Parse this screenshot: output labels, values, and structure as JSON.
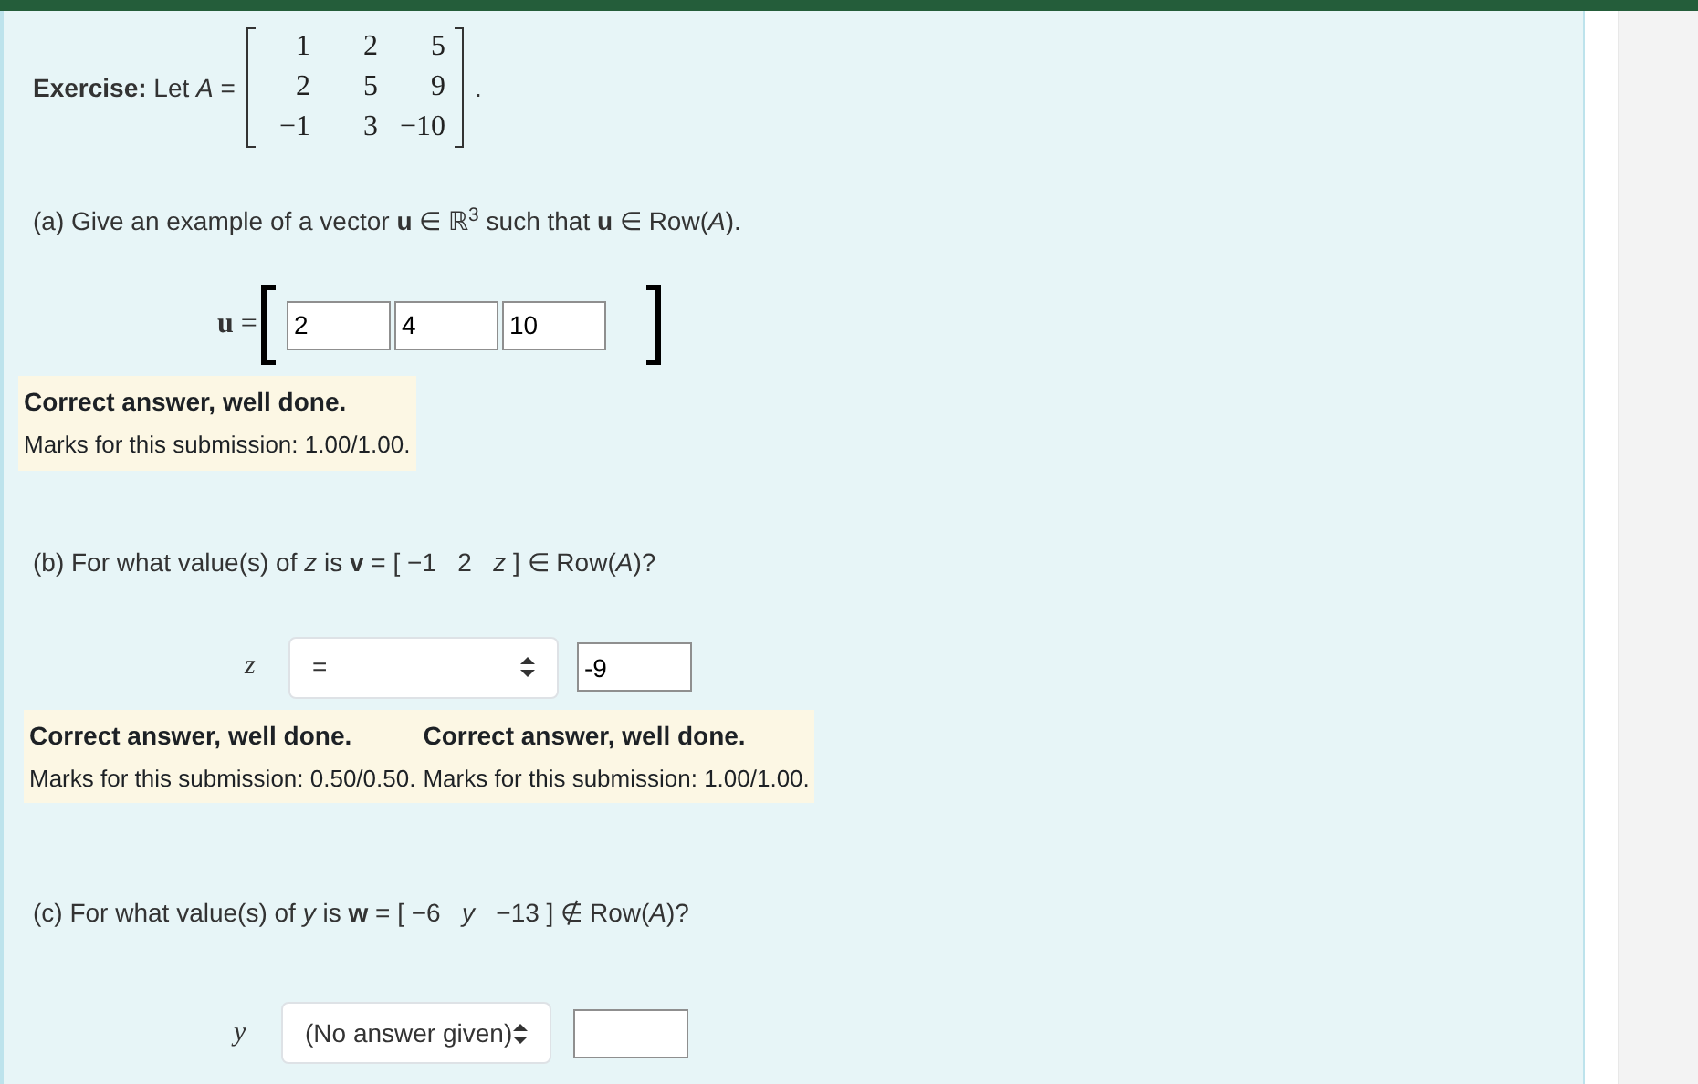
{
  "exercise": {
    "intro": "**Exercise:** Let *A* =",
    "matrix": [
      [
        "1",
        "2",
        "5"
      ],
      [
        "2",
        "5",
        "9"
      ],
      [
        "−1",
        "3",
        "−10"
      ]
    ],
    "end": "."
  },
  "part_a": {
    "question": "(a) Give an example of a vector **u** ∈ ℝ$^{3}$ such that **u** ∈ Row(*A*).",
    "label": "**u** =",
    "inputs": [
      "2",
      "4",
      "10"
    ],
    "feedback": [
      {
        "title": "Correct answer, well done.",
        "marks": "Marks for this submission: 1.00/1.00."
      }
    ]
  },
  "part_b": {
    "question": "(b) For what value(s) of *z* is **v** = [ −1   2   *z* ] ∈ Row(*A*)?",
    "variable": "z",
    "select": "=",
    "input": "-9",
    "feedback": [
      {
        "title": "Correct answer, well done.",
        "marks": "Marks for this submission: 0.50/0.50."
      },
      {
        "title": "Correct answer, well done.",
        "marks": "Marks for this submission: 1.00/1.00."
      }
    ]
  },
  "part_c": {
    "question": "(c) For what value(s) of *y* is **w** = [ −6   *y*   −13 ] ∉ Row(*A*)?",
    "variable": "y",
    "select": "(No answer given)"
  }
}
